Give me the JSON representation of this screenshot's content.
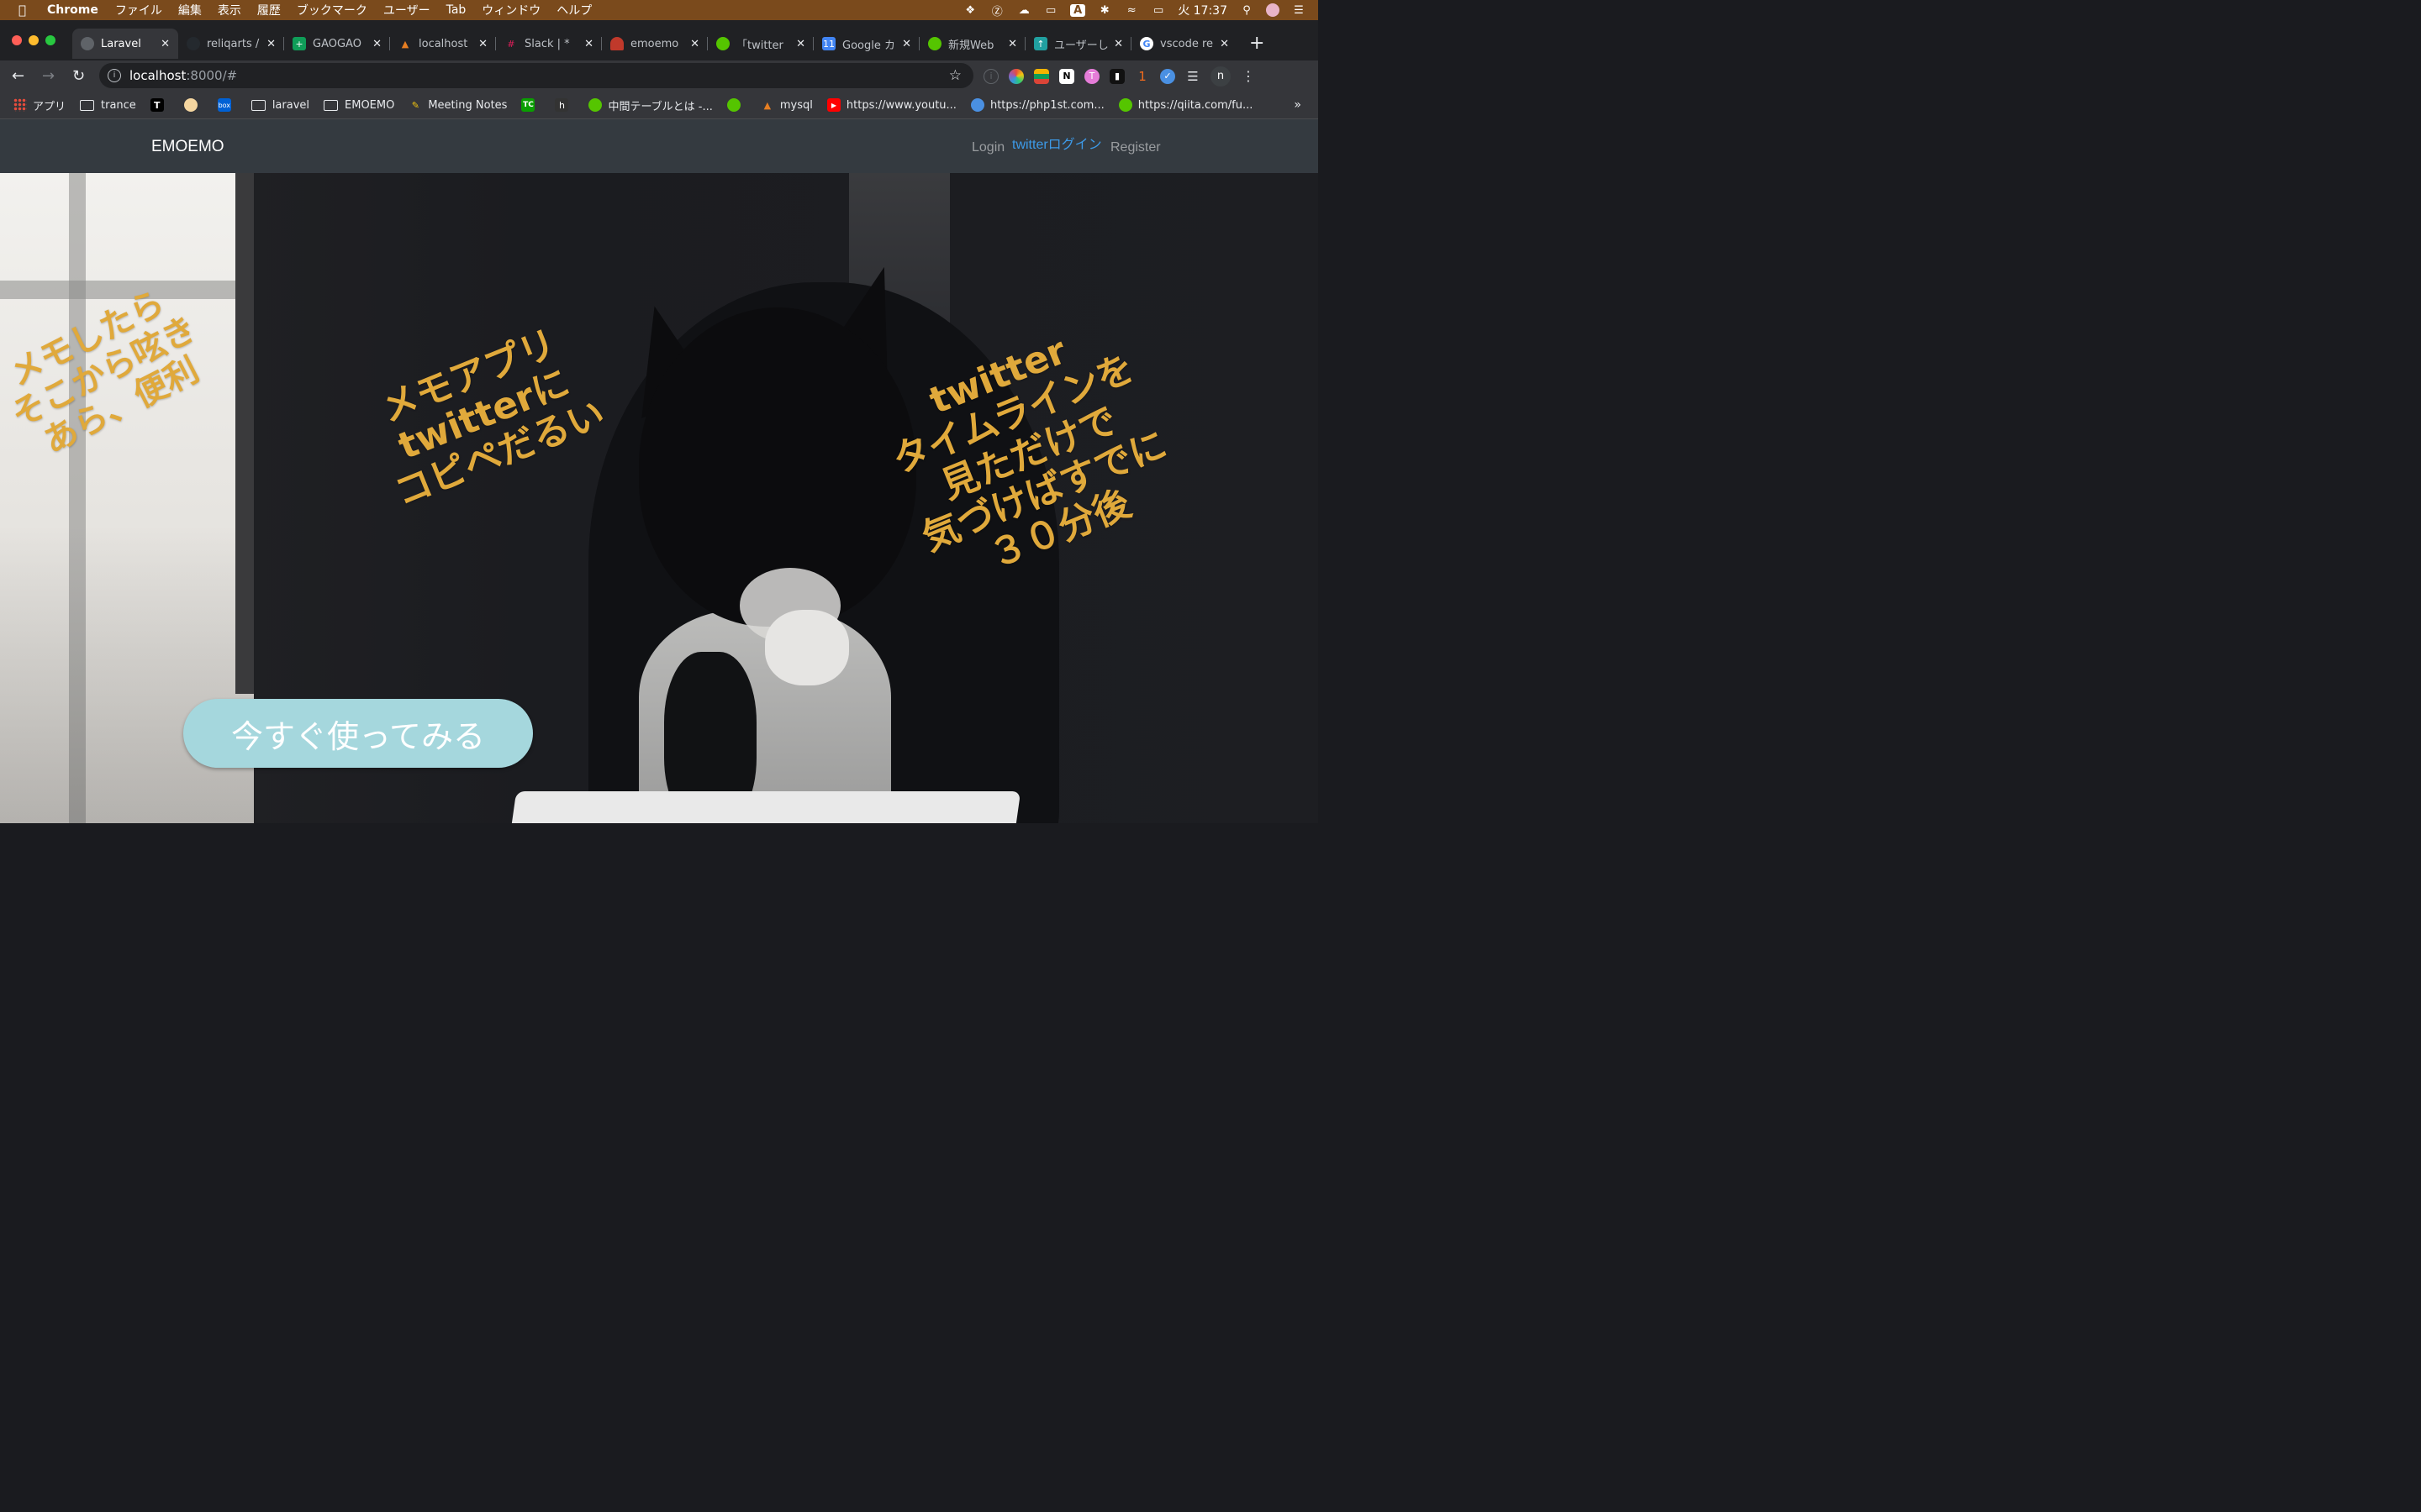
{
  "menubar": {
    "app_name": "Chrome",
    "items": [
      "ファイル",
      "編集",
      "表示",
      "履歴",
      "ブックマーク",
      "ユーザー",
      "Tab",
      "ウィンドウ",
      "ヘルプ"
    ],
    "clock": "火 17:37",
    "status_icons": [
      "dropbox-icon",
      "onepassword-icon",
      "cloud-icon",
      "airplay-icon",
      "input-method-icon",
      "bluetooth-icon",
      "wifi-icon",
      "battery-icon",
      "search-icon",
      "user-avatar-icon",
      "list-icon"
    ],
    "input_method": "A"
  },
  "tabs": [
    {
      "label": "Laravel",
      "active": true,
      "icon_color": "#5f6368",
      "icon": "globe-icon"
    },
    {
      "label": "reliqarts /",
      "active": false,
      "icon_color": "#24292e",
      "icon": "github-icon"
    },
    {
      "label": "GAOGAO",
      "active": false,
      "icon_color": "#0f9d58",
      "icon": "sheets-icon"
    },
    {
      "label": "localhost",
      "active": false,
      "icon_color": "#c0392b",
      "icon": "phpmyadmin-icon"
    },
    {
      "label": "Slack | * ",
      "active": false,
      "icon_color": "#4a154b",
      "icon": "slack-icon"
    },
    {
      "label": "emoemo",
      "active": false,
      "icon_color": "#e74c3c",
      "icon": "heroku-icon"
    },
    {
      "label": "「twitter",
      "active": false,
      "icon_color": "#55c500",
      "icon": "qiita-icon"
    },
    {
      "label": "Google カ",
      "active": false,
      "icon_color": "#4285f4",
      "icon": "calendar-icon"
    },
    {
      "label": "新規Web",
      "active": false,
      "icon_color": "#55c500",
      "icon": "qiita-icon"
    },
    {
      "label": "ユーザーし",
      "active": false,
      "icon_color": "#21a0a0",
      "icon": "upload-icon"
    },
    {
      "label": "vscode re",
      "active": false,
      "icon_color": "#ffffff",
      "icon": "google-icon"
    }
  ],
  "omnibox": {
    "host": "localhost",
    "path": ":8000/#"
  },
  "bookmarks": [
    {
      "label": "アプリ",
      "icon": "apps-grid-icon"
    },
    {
      "label": "trance",
      "icon": "folder-icon"
    },
    {
      "label": "",
      "icon": "t-logo-icon"
    },
    {
      "label": "",
      "icon": "ninja-icon"
    },
    {
      "label": "",
      "icon": "box-icon"
    },
    {
      "label": "laravel",
      "icon": "folder-icon"
    },
    {
      "label": "EMOEMO",
      "icon": "folder-icon"
    },
    {
      "label": "Meeting Notes",
      "icon": "pencil-icon"
    },
    {
      "label": "",
      "icon": "techcrunch-icon"
    },
    {
      "label": "",
      "icon": "hatena-icon"
    },
    {
      "label": "中間テーブルとは -...",
      "icon": "qiita-icon"
    },
    {
      "label": "",
      "icon": "qiita-icon"
    },
    {
      "label": "mysql",
      "icon": "phpmyadmin-icon"
    },
    {
      "label": "https://www.youtu...",
      "icon": "youtube-icon"
    },
    {
      "label": "https://php1st.com...",
      "icon": "php1st-icon"
    },
    {
      "label": "https://qiita.com/fu...",
      "icon": "qiita-icon"
    }
  ],
  "site": {
    "brand": "EMOEMO",
    "nav": {
      "login": "Login",
      "twitter_login": "twitterログイン",
      "register": "Register"
    },
    "hero": {
      "message_left": "メモしたら\nそこから呟き\nあら、便利",
      "message_center": "メモアプリ\ntwitterに\nコピペだるい",
      "message_right": "twitter\nタイムラインを\n見ただけで\n気づけばすでに\n３０分後",
      "cta_label": "今すぐ使ってみる"
    }
  },
  "colors": {
    "accent_text": "#e0a93b",
    "cta_bg": "#a5d7dd",
    "navbar_bg": "#343a40",
    "twitter_link": "#3d9ae8"
  },
  "extensions": [
    "onepassword-ext-icon",
    "color-ext-icon",
    "stack-ext-icon",
    "notion-ext-icon",
    "toggl-ext-icon",
    "bookmark-ext-icon",
    "badge-ext-icon",
    "vimeo-ext-icon",
    "playlist-icon",
    "profile-icon",
    "more-menu-icon"
  ],
  "extension_badge": "1",
  "profile_initial": "n"
}
